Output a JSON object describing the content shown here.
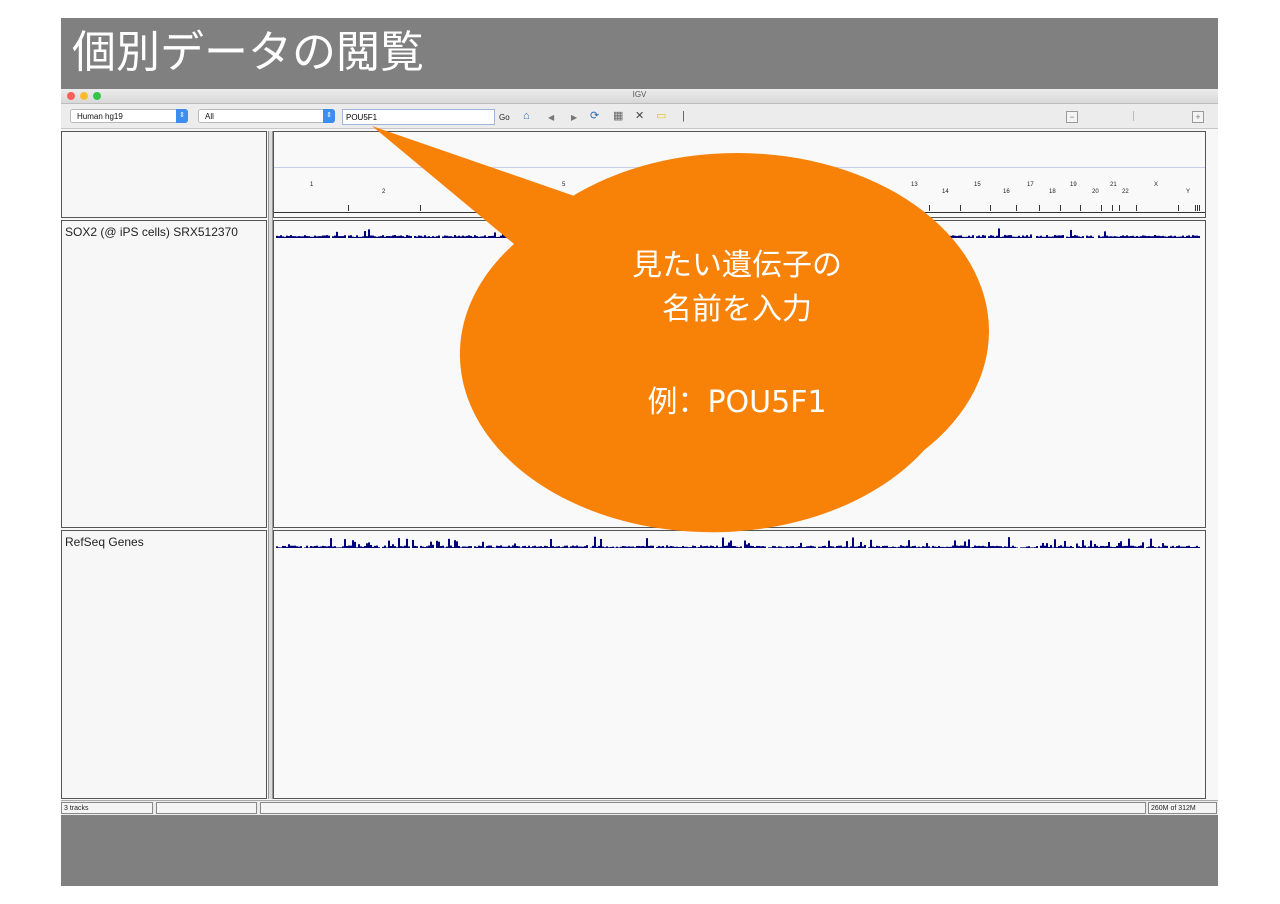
{
  "slide": {
    "title": "個別データの閲覧"
  },
  "window": {
    "title": "IGV",
    "traffic_colors": [
      "#fc5f57",
      "#fdbc2f",
      "#33c748"
    ]
  },
  "toolbar": {
    "genome": "Human hg19",
    "chromosome": "All",
    "locus": "POU5F1",
    "go_label": "Go",
    "zoom_out_symbol": "−",
    "zoom_in_symbol": "+",
    "icons": [
      "home-icon",
      "back-icon",
      "forward-icon",
      "refresh-icon",
      "region-icon",
      "close-icon",
      "popup-icon",
      "roi-bar-icon"
    ]
  },
  "ruler": {
    "chromosomes": [
      "1",
      "2",
      "5",
      "13",
      "14",
      "15",
      "16",
      "17",
      "18",
      "19",
      "20",
      "21",
      "22",
      "X",
      "Y"
    ]
  },
  "tracks": [
    {
      "name": "SOX2 (@ iPS cells) SRX512370",
      "color": "#00007a"
    },
    {
      "name": "RefSeq Genes",
      "color": "#00007a"
    }
  ],
  "status": {
    "track_count": "3 tracks",
    "memory": "260M of 312M"
  },
  "callout": {
    "color": "#f88207",
    "line1": "見たい遺伝子の",
    "line2": "名前を入力",
    "line3": "例：POU5F1"
  }
}
